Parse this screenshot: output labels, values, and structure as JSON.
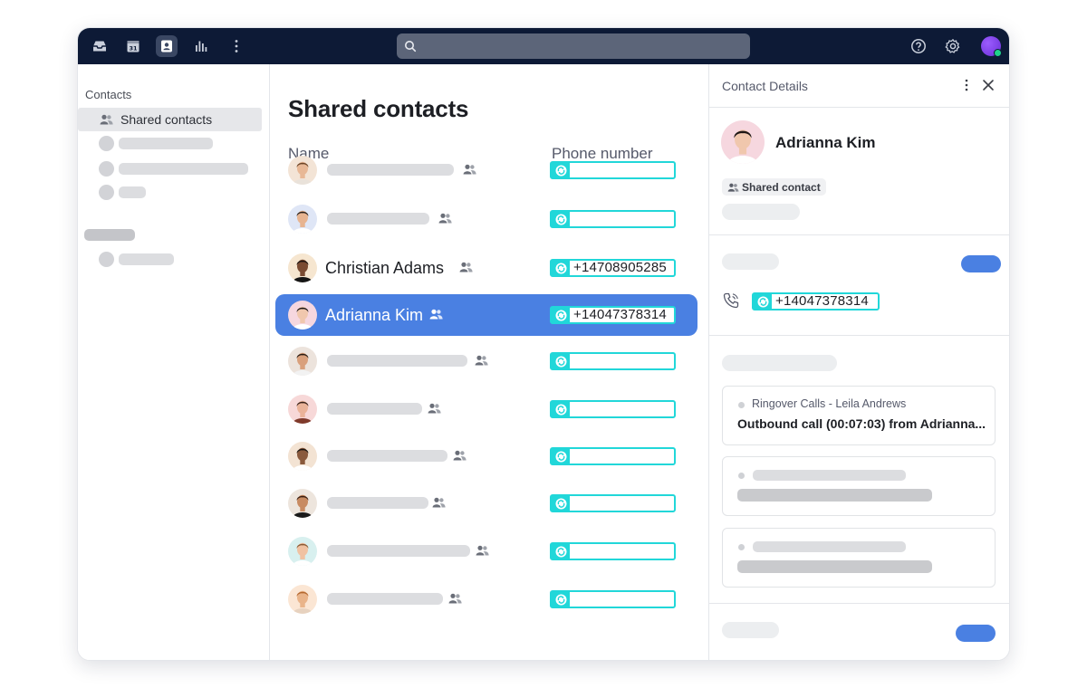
{
  "search": {
    "placeholder": ""
  },
  "sidebar": {
    "heading": "Contacts",
    "active_item": "Shared contacts"
  },
  "main": {
    "title": "Shared contacts",
    "col_name": "Name",
    "col_phone": "Phone number",
    "rows": [
      {
        "name": "",
        "phone": "",
        "selected": false
      },
      {
        "name": "",
        "phone": "",
        "selected": false
      },
      {
        "name": "Christian Adams",
        "phone": "+14708905285",
        "selected": false
      },
      {
        "name": "Adrianna Kim",
        "phone": "+14047378314",
        "selected": true
      },
      {
        "name": "",
        "phone": "",
        "selected": false
      },
      {
        "name": "",
        "phone": "",
        "selected": false
      },
      {
        "name": "",
        "phone": "",
        "selected": false
      },
      {
        "name": "",
        "phone": "",
        "selected": false
      },
      {
        "name": "",
        "phone": "",
        "selected": false
      },
      {
        "name": "",
        "phone": "",
        "selected": false
      }
    ]
  },
  "details": {
    "title": "Contact Details",
    "name": "Adrianna Kim",
    "chip": "Shared contact",
    "phone": "+14047378314",
    "call_source": "Ringover Calls - Leila Andrews",
    "call_desc": "Outbound call  (00:07:03) from Adrianna..."
  },
  "colors": {
    "topbar": "#0d1a36",
    "accent": "#4a80e2",
    "phone_badge": "#21d7d9"
  }
}
